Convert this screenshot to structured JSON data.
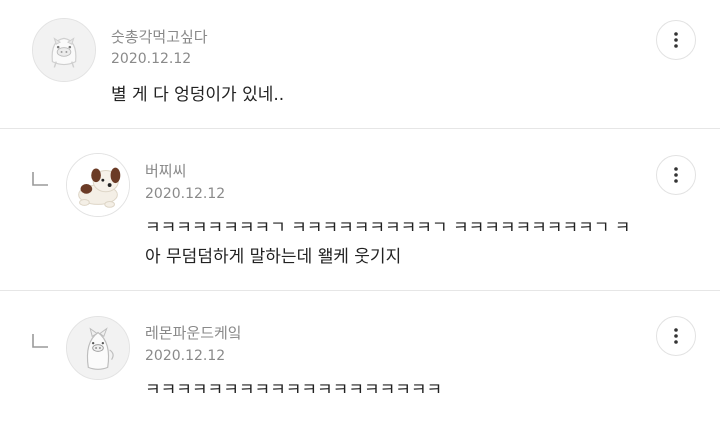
{
  "comments": [
    {
      "author": "숫총각먹고싶다",
      "date": "2020.12.12",
      "lines": [
        "별 게 다 엉덩이가 있네.."
      ],
      "avatar_icon": "pig-face-icon",
      "is_reply": false
    },
    {
      "author": "버찌씨",
      "date": "2020.12.12",
      "lines": [
        "ㅋㅋㅋㅋㅋㅋㅋㅋㄱ ㅋㅋㅋㅋㅋㅋㅋㅋㅋㄱ ㅋㅋㅋㅋㅋㅋㅋㅋㅋㄱ ㅋ",
        "아 무덤덤하게 말하는데 왤케 웃기지"
      ],
      "avatar_icon": "plush-dog-icon",
      "is_reply": true
    },
    {
      "author": "레몬파운드케잌",
      "date": "2020.12.12",
      "lines": [
        "ㅋㅋㅋㅋㅋㅋㅋㅋㅋㅋㅋㅋㅋㅋㅋㅋㅋㅋㅋ"
      ],
      "avatar_icon": "pig-character-icon",
      "is_reply": true
    }
  ],
  "icons": {
    "more": "more-vertical-icon",
    "reply": "reply-indent-icon"
  },
  "colors": {
    "meta": "#8a8a8a",
    "text": "#222222",
    "divider": "#e6e6e6"
  }
}
